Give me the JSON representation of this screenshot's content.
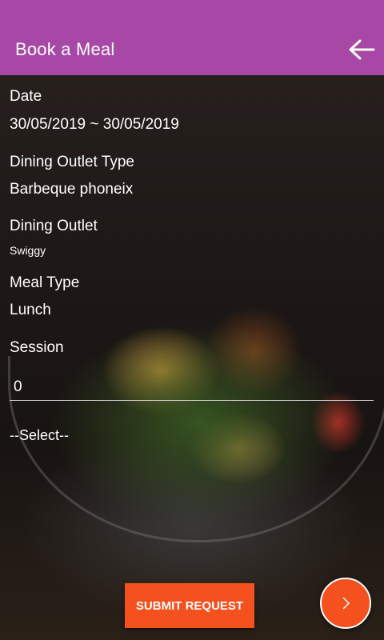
{
  "app_bar": {
    "title": "Book a Meal",
    "back_icon": "arrow-left-icon"
  },
  "form": {
    "date": {
      "label": "Date",
      "value": "30/05/2019 ~ 30/05/2019"
    },
    "outlet_type": {
      "label": "Dining Outlet Type",
      "value": "Barbeque phoneix"
    },
    "outlet": {
      "label": "Dining Outlet",
      "value": "Swiggy"
    },
    "meal_type": {
      "label": "Meal Type",
      "value": "Lunch"
    },
    "session": {
      "label": "Session",
      "value": "0"
    },
    "select": {
      "value": "--Select--"
    }
  },
  "actions": {
    "submit_label": "SUBMIT REQUEST",
    "next_icon": "chevron-right-icon"
  },
  "colors": {
    "accent": "#a748a6",
    "action": "#f4511e"
  }
}
